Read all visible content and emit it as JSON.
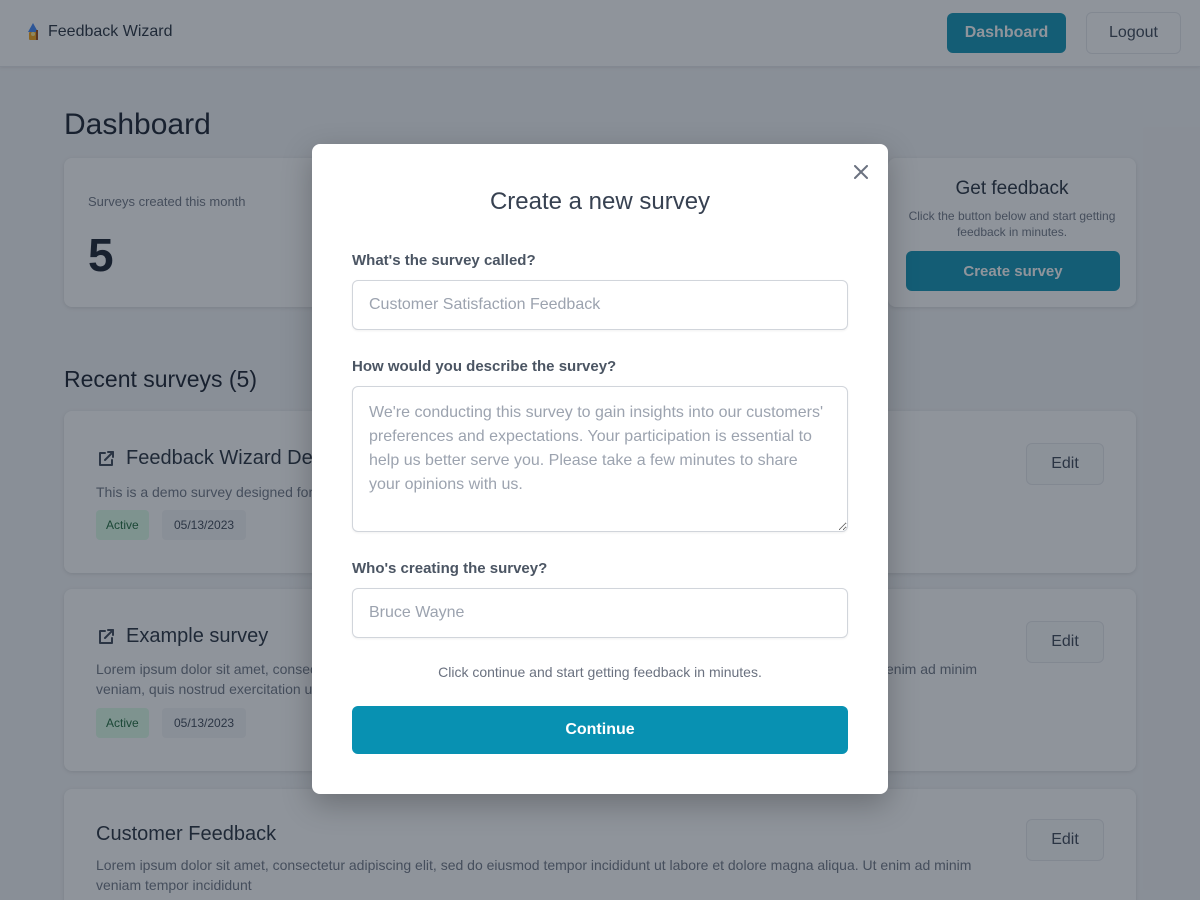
{
  "app": {
    "brand_name": "Feedback Wizard"
  },
  "nav": {
    "dashboard_label": "Dashboard",
    "logout_label": "Logout"
  },
  "page": {
    "title": "Dashboard"
  },
  "stats": {
    "label": "Surveys created this month",
    "value": "5"
  },
  "get_feedback": {
    "title": "Get feedback",
    "text": "Click the button below and start getting feedback in minutes.",
    "button_label": "Create survey"
  },
  "recent": {
    "title": "Recent surveys (5)",
    "surveys": [
      {
        "title": "Feedback Wizard De",
        "description": "This is a demo survey designed for",
        "status": "Active",
        "date": "05/13/2023",
        "edit_label": "Edit",
        "has_link_icon": true
      },
      {
        "title": "Example survey",
        "description_left": "Lorem ipsum dolor sit amet, consec",
        "description_left_2": "veniam, quis nostrud exercitation u",
        "description_right": "enim ad minim",
        "status": "Active",
        "date": "05/13/2023",
        "edit_label": "Edit",
        "has_link_icon": true
      },
      {
        "title": "Customer Feedback",
        "description": "Lorem ipsum dolor sit amet, consectetur adipiscing elit, sed do eiusmod tempor incididunt ut labore et dolore magna aliqua. Ut enim ad minim veniam tempor incididunt",
        "edit_label": "Edit",
        "has_link_icon": false
      }
    ]
  },
  "modal": {
    "title": "Create a new survey",
    "name_label": "What's the survey called?",
    "name_placeholder": "Customer Satisfaction Feedback",
    "description_label": "How would you describe the survey?",
    "description_placeholder": "We're conducting this survey to gain insights into our customers' preferences and expectations. Your participation is essential to help us better serve you. Please take a few minutes to share your opinions with us.",
    "creator_label": "Who's creating the survey?",
    "creator_placeholder": "Bruce Wayne",
    "hint": "Click continue and start getting feedback in minutes.",
    "continue_label": "Continue"
  },
  "colors": {
    "accent": "#0891b2",
    "active_badge_bg": "#dcfce7",
    "active_badge_text": "#166534"
  }
}
